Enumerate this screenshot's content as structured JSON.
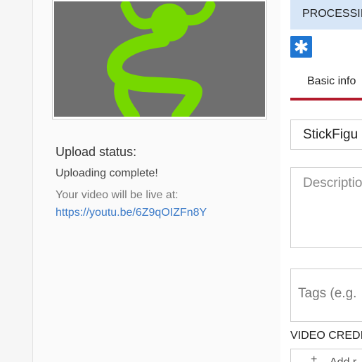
{
  "upload": {
    "status_title": "Upload status:",
    "status_message": "Uploading complete!",
    "live_label": "Your video will be live at:",
    "video_url": "https://youtu.be/6Z9qOIZFn8Y"
  },
  "processing": {
    "label": "PROCESSII"
  },
  "badge": {
    "icon": "asterisk-icon",
    "glyph": "✱"
  },
  "tabs": [
    {
      "label": "Basic info",
      "active": true
    }
  ],
  "form": {
    "title_value": "StickFigu",
    "description_placeholder": "Descriptio",
    "tags_placeholder": "Tags (e.g."
  },
  "credits": {
    "heading": "VIDEO CREDI",
    "add_icon": "plus-icon",
    "add_label": "Add r"
  },
  "colors": {
    "accent_blue": "#1f76d2",
    "tab_underline": "#b31b2c",
    "link": "#3b7ac8",
    "banner": "#d7e6f7",
    "figure_green": "#76d800",
    "thumbnail_bg": "#6f6f6f"
  }
}
